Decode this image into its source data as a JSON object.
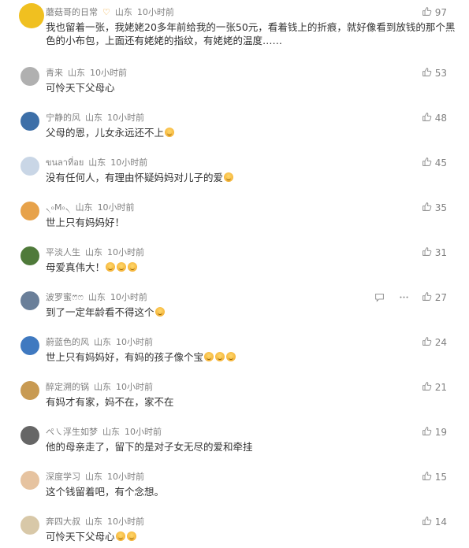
{
  "comments": [
    {
      "user": "蘑菇哥的日常",
      "badge": "♡",
      "location": "山东",
      "time": "10小时前",
      "text": "我也留着一张，我姥姥20多年前给我的一张50元，看着钱上的折痕，就好像看到放钱的那个黑色的小布包，上面还有姥姥的指纹，有姥姥的温度……",
      "emoji_count": 0,
      "likes": "97",
      "avatar_color": "#f0c020"
    },
    {
      "user": "青来",
      "location": "山东",
      "time": "10小时前",
      "text": "可怜天下父母心",
      "emoji_count": 0,
      "likes": "53",
      "avatar_color": "#b0b0b0"
    },
    {
      "user": "宁静的风",
      "location": "山东",
      "time": "10小时前",
      "text": "父母的恩，儿女永远还不上",
      "emoji_count": 1,
      "likes": "48",
      "avatar_color": "#3d6fa8"
    },
    {
      "user": "ขนลาที่อย",
      "location": "山东",
      "time": "10小时前",
      "text": "没有任何人，有理由怀疑妈妈对儿子的爱",
      "emoji_count": 1,
      "likes": "45",
      "avatar_color": "#c9d6e6"
    },
    {
      "user": "৲৹M৹৲",
      "location": "山东",
      "time": "10小时前",
      "text": "世上只有妈妈好！",
      "emoji_count": 0,
      "likes": "35",
      "avatar_color": "#e7a24a"
    },
    {
      "user": "平淡人生",
      "location": "山东",
      "time": "10小时前",
      "text": "母爱真伟大！",
      "emoji_count": 3,
      "likes": "31",
      "avatar_color": "#4f7a3a"
    },
    {
      "user": "波罗蜜ෆ⃛ෆ",
      "location": "山东",
      "time": "10小时前",
      "text": "到了一定年龄看不得这个",
      "emoji_count": 1,
      "likes": "27",
      "avatar_color": "#6a7f99",
      "show_actions": true
    },
    {
      "user": "蔚蓝色的风",
      "location": "山东",
      "time": "10小时前",
      "text": "世上只有妈妈好，有妈的孩子像个宝",
      "emoji_count": 3,
      "likes": "24",
      "avatar_color": "#3f79c0"
    },
    {
      "user": "醉定溯的锅",
      "location": "山东",
      "time": "10小时前",
      "text": "有妈才有家，妈不在，家不在",
      "emoji_count": 0,
      "likes": "21",
      "avatar_color": "#c89a52"
    },
    {
      "user": "ぺ㇏浮生如梦",
      "location": "山东",
      "time": "10小时前",
      "text": "他的母亲走了，留下的是对子女无尽的爱和牵挂",
      "emoji_count": 0,
      "likes": "19",
      "avatar_color": "#666666"
    },
    {
      "user": "深度学习",
      "location": "山东",
      "time": "10小时前",
      "text": "这个钱留着吧，有个念想。",
      "emoji_count": 0,
      "likes": "15",
      "avatar_color": "#e6c3a0"
    },
    {
      "user": "奔四大叔",
      "location": "山东",
      "time": "10小时前",
      "text": "可怜天下父母心",
      "emoji_count": 2,
      "likes": "14",
      "avatar_color": "#d8c8a8"
    }
  ],
  "icons": {
    "like": "thumbs-up-icon",
    "reply": "reply-icon",
    "more": "more-icon"
  }
}
